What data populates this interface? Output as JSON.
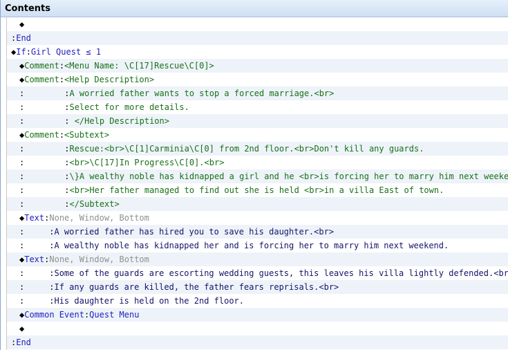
{
  "window": {
    "title": "Contents"
  },
  "event_commands": [
    {
      "type": "blank",
      "indent": 1
    },
    {
      "type": "end",
      "indent": 0,
      "label": "End"
    },
    {
      "type": "if",
      "indent": 0,
      "keyword": "If",
      "condition": "Girl Quest ≤ 1"
    },
    {
      "type": "comment",
      "indent": 1,
      "keyword": "Comment",
      "text": "<Menu Name: \\C[17]Rescue\\C[0]>"
    },
    {
      "type": "comment",
      "indent": 1,
      "keyword": "Comment",
      "text": "<Help Description>"
    },
    {
      "type": "comment-cont",
      "indent": 1,
      "text": "A worried father wants to stop a forced marriage.<br>"
    },
    {
      "type": "comment-cont",
      "indent": 1,
      "text": "Select for more details."
    },
    {
      "type": "comment-cont",
      "indent": 1,
      "text": " </Help Description>"
    },
    {
      "type": "comment",
      "indent": 1,
      "keyword": "Comment",
      "text": "<Subtext>"
    },
    {
      "type": "comment-cont",
      "indent": 1,
      "text": "Rescue:<br>\\C[1]Carminia\\C[0] from 2nd floor.<br>Don't kill any guards."
    },
    {
      "type": "comment-cont",
      "indent": 1,
      "text": "<br>\\C[17]In Progress\\C[0].<br>"
    },
    {
      "type": "comment-cont",
      "indent": 1,
      "text": "\\}A wealthy noble has kidnapped a girl and he <br>is forcing her to marry him next weekend."
    },
    {
      "type": "comment-cont",
      "indent": 1,
      "text": "<br>Her father managed to find out she is held <br>in a villa East of town."
    },
    {
      "type": "comment-cont",
      "indent": 1,
      "text": "</Subtext>"
    },
    {
      "type": "text",
      "indent": 1,
      "keyword": "Text",
      "params": "None, Window, Bottom"
    },
    {
      "type": "text-cont",
      "indent": 1,
      "text": "A worried father has hired you to save his daughter.<br>"
    },
    {
      "type": "text-cont",
      "indent": 1,
      "text": "A wealthy noble has kidnapped her and is forcing her to marry him next weekend."
    },
    {
      "type": "text",
      "indent": 1,
      "keyword": "Text",
      "params": "None, Window, Bottom"
    },
    {
      "type": "text-cont",
      "indent": 1,
      "text": "Some of the guards are escorting wedding guests, this leaves his villa lightly defended.<br>"
    },
    {
      "type": "text-cont",
      "indent": 1,
      "text": "If any guards are killed, the father fears reprisals.<br>"
    },
    {
      "type": "text-cont",
      "indent": 1,
      "text": "His daughter is held on the 2nd floor."
    },
    {
      "type": "common-event",
      "indent": 1,
      "keyword": "Common Event",
      "text": "Quest Menu"
    },
    {
      "type": "blank",
      "indent": 1
    },
    {
      "type": "end",
      "indent": 0,
      "label": "End"
    }
  ],
  "colors": {
    "keyword": "#1d1dbf",
    "comment": "#187018",
    "text": "#14146a",
    "params": "#909090",
    "row_alt": "#eef3f9"
  }
}
